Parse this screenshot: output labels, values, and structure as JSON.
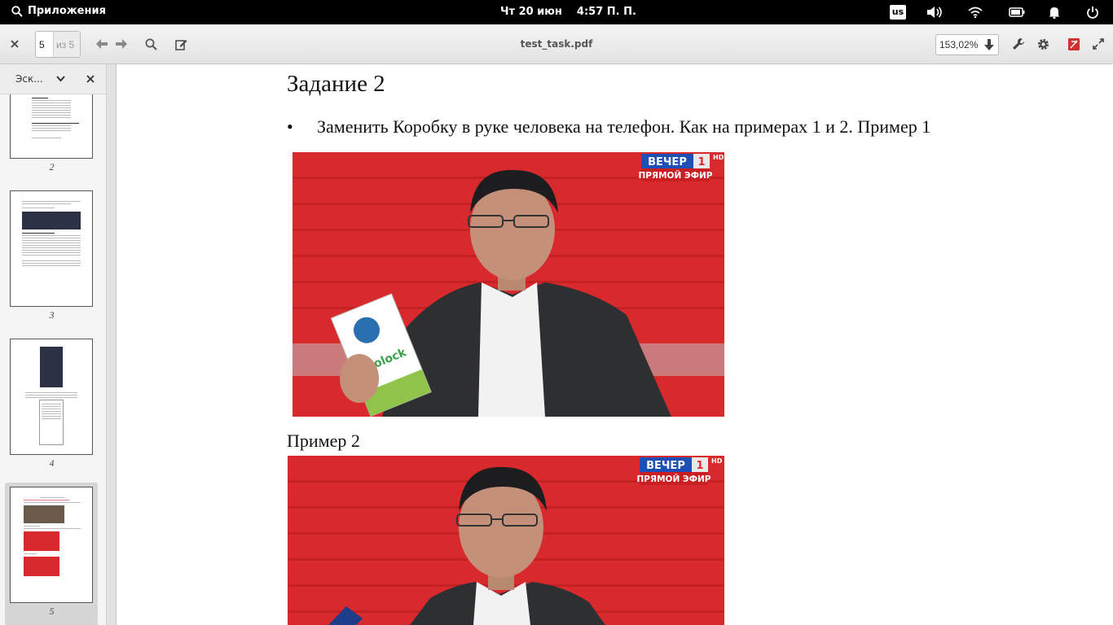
{
  "panel": {
    "apps_label": "Приложения",
    "date": "Чт 20 июн",
    "time": "4:57 П. П.",
    "keyboard_layout": "us"
  },
  "toolbar": {
    "current_page": "5",
    "page_of": "из 5",
    "document_title": "test_task.pdf",
    "zoom": "153,02%"
  },
  "sidebar": {
    "header_label": "Эск...",
    "thumbnails": [
      {
        "page": "2"
      },
      {
        "page": "3"
      },
      {
        "page": "4"
      },
      {
        "page": "5",
        "selected": true
      }
    ]
  },
  "document": {
    "heading": "Задание 2",
    "bullet_symbol": "•",
    "bullet_text": "Заменить Коробку в руке человека на телефон. Как на примерах 1 и 2. Пример 1",
    "example2_label": "Пример 2",
    "tv_logo_top": "ВЕЧЕР",
    "tv_channel": "1",
    "tv_hd": "HD",
    "tv_logo_bottom": "ПРЯМОЙ ЭФИР",
    "box_brand": "Micolock"
  },
  "colors": {
    "panel_bg": "#000000",
    "photo_red": "#d82a2c",
    "tv_blue": "#1e4fb5"
  }
}
